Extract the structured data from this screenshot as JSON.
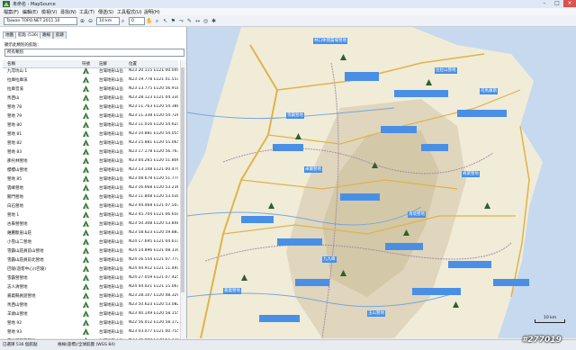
{
  "window": {
    "title": "未命名 - MapSource"
  },
  "menu": [
    "檔案(F)",
    "編輯(E)",
    "檢視(V)",
    "尋找(N)",
    "工具(T)",
    "傳送(S)",
    "工具程式(U)",
    "說明(H)"
  ],
  "toolbar": {
    "map_product": "Taiwan TOPO.NET 2011.10",
    "zoom": "10 km",
    "view": "0"
  },
  "tabs": [
    "地圖",
    "航點 (536)",
    "路線",
    "航跡"
  ],
  "filter": {
    "label": "顯示此類別的航點：",
    "value": "所有類別"
  },
  "columns": [
    "名稱",
    "符號",
    "註解",
    "位置"
  ],
  "rows": [
    {
      "name": "九芎坑山 1",
      "comment": "台灣地形山岳",
      "position": "N23 20.115 E121 00.049"
    },
    {
      "name": "拉庫拉庫溪",
      "comment": "台灣地形山岳",
      "position": "N23 19.778 E121 01.551"
    },
    {
      "name": "拉庫音溪",
      "comment": "台灣地形山岳",
      "position": "N23 13.775 E120 56.918"
    },
    {
      "name": "馬西山",
      "comment": "台灣地形山岳",
      "position": "N23 28.123 E121 04.330"
    },
    {
      "name": "營地 78",
      "comment": "台灣地形山岳",
      "position": "N23 11.763 E120 54.388"
    },
    {
      "name": "營地 79",
      "comment": "台灣地形山岳",
      "position": "N23 11.338 E120 54.726"
    },
    {
      "name": "營地 80",
      "comment": "台灣地形山岳",
      "position": "N23 11.016 E120 54.621"
    },
    {
      "name": "營地 81",
      "comment": "台灣地形山岳",
      "position": "N23 10.881 E120 54.055"
    },
    {
      "name": "營地 82",
      "comment": "台灣地形山岳",
      "position": "N23 15.881 E120 55.065"
    },
    {
      "name": "營地 83",
      "comment": "台灣地形山岳",
      "position": "N23 17.178 E120 56.763"
    },
    {
      "name": "那托林營地",
      "comment": "台灣地形山岳",
      "position": "N23 04.265 E120 51.806"
    },
    {
      "name": "櫻櫻山營地",
      "comment": "台灣地形山岳",
      "position": "N23 13.148 E121 00.470"
    },
    {
      "name": "營地 85",
      "comment": "台灣地形山岳",
      "position": "N23 08.678 E120 51.774"
    },
    {
      "name": "雲峰營地",
      "comment": "台灣地形山岳",
      "position": "N23 16.668 E120 53.236"
    },
    {
      "name": "關門營地",
      "comment": "台灣地形山岳",
      "position": "N23 11.808 E120 53.030"
    },
    {
      "name": "白石營地",
      "comment": "台灣地形山岳",
      "position": "N23 44.468 E121 07.507"
    },
    {
      "name": "營地 1",
      "comment": "台灣地形山岳",
      "position": "N23 45.704 E121 06.650"
    },
    {
      "name": "古車營營地",
      "comment": "台灣地形山岳",
      "position": "N23 50.308 E120 53.848"
    },
    {
      "name": "錐麓斷崖山莊",
      "comment": "台灣地形山岳",
      "position": "N23 58.623 E120 59.887"
    },
    {
      "name": "小雪山二營地",
      "comment": "台灣地形山岳",
      "position": "N24 17.695 E121 04.611"
    },
    {
      "name": "雪霸山莊員前山營地",
      "comment": "台灣地形山岳",
      "position": "N24 14.896 E121 08.130"
    },
    {
      "name": "雪霸山莊員前北營地",
      "comment": "台灣地形山岳",
      "position": "N24 16.554 E121 07.771"
    },
    {
      "name": "巴陵(遊客中心)(巴陵)",
      "comment": "台灣地形山岳",
      "position": "N24 44.912 E121 11.491"
    },
    {
      "name": "雪霸營營地",
      "comment": "台灣地形山岳",
      "position": "N24 27.059 E121 07.425"
    },
    {
      "name": "志人清營地",
      "comment": "台灣地形山岳",
      "position": "N24 44.021 E121 15.061"
    },
    {
      "name": "嘉義縣員遊營地",
      "comment": "台灣地形山岳",
      "position": "N23 28.107 E120 48.329"
    },
    {
      "name": "馬西山營地",
      "comment": "台灣地形山岳",
      "position": "N23 50.623 E120 53.082"
    },
    {
      "name": "羊頭山營地",
      "comment": "台灣地形山岳",
      "position": "N23 40.149 E120 58.155"
    },
    {
      "name": "營地 92",
      "comment": "台灣地形山岳",
      "position": "N22 56.012 E120 58.172"
    },
    {
      "name": "營地 93",
      "comment": "台灣地形山岳",
      "position": "N23 03.077 E121 00.755"
    },
    {
      "name": "森林遊樂區營地",
      "comment": "台灣地形山岳",
      "position": "N22 26.808 E120 51.138"
    }
  ],
  "map": {
    "place_labels": [
      "林口休閒農場營地",
      "拉拉山營地",
      "司馬庫斯",
      "雪霸營地",
      "嘉義營地",
      "卓蘭營地",
      "清境營地",
      "九九峰",
      "奇萊營地",
      "玉山營地"
    ],
    "scale": "10 km"
  },
  "status": {
    "left": "已選擇 536 個航點",
    "mid": "格線(座標)/全球航圖 (WGS 84)"
  },
  "watermark": "#277019",
  "colors": {
    "label_bg": "#4a8fe6",
    "pin": "#2f5f2f",
    "road": "#e0b34a"
  }
}
